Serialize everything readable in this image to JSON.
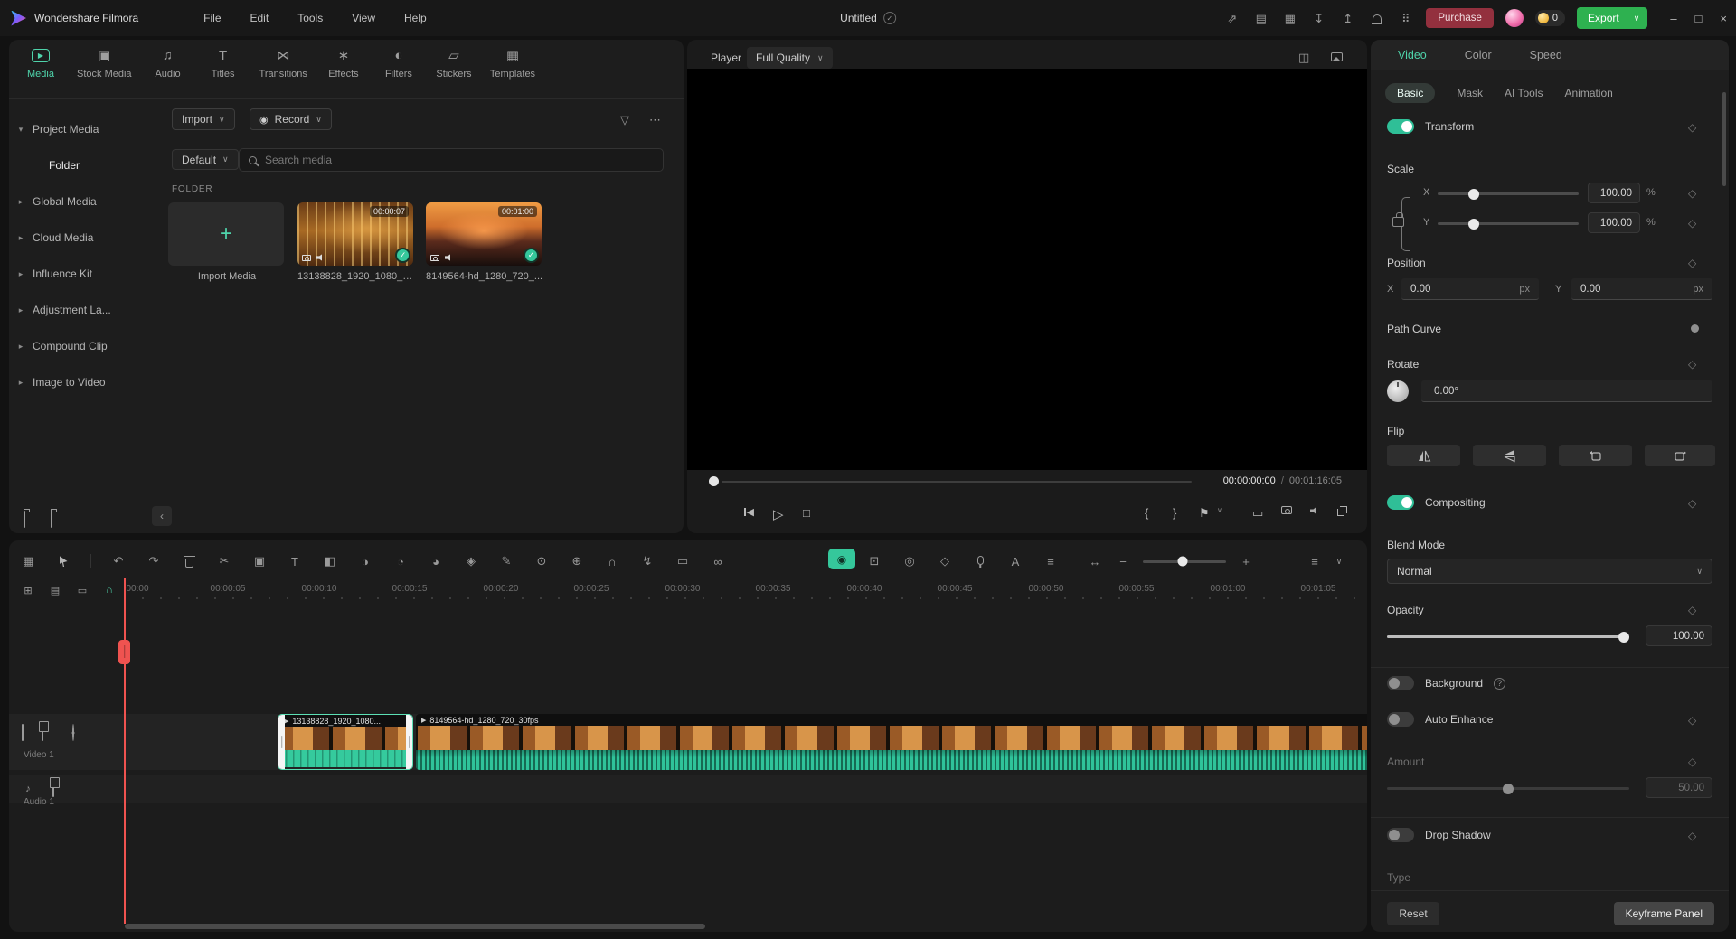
{
  "icons": {
    "caret_down": "▾",
    "caret_right": "▸",
    "chevron": "∨",
    "chevron_left": "‹",
    "plus": "+",
    "minus": "−",
    "check": "✓",
    "more": "⋯",
    "filter": "▽",
    "record": "◉",
    "play": "▶",
    "play_outline": "▷",
    "play_back": "◀",
    "stop": "□",
    "flag": "⚑",
    "brace_l": "{",
    "brace_r": "}",
    "undo": "↶",
    "redo": "↷",
    "scissors": "✂",
    "crop": "▣",
    "letter_t": "T",
    "letter_a": "A",
    "mask": "◧",
    "chroma": "◑",
    "clock": "◔",
    "dot_circle": "⊙",
    "color": "◕",
    "diamond_solid": "◈",
    "pen": "✎",
    "zoom_fit": "⊕",
    "magnet": "∩",
    "bolt": "↯",
    "grid": "▦",
    "panel": "▤",
    "rect": "▭",
    "link": "∞",
    "webcam": "◎",
    "screen": "⊡",
    "lines": "≡",
    "arrows_h": "↔",
    "dual": "◫",
    "note": "♪",
    "diamond": "◇",
    "question": "?",
    "close": "×",
    "maximize_sq": "□",
    "dash": "–",
    "share": "⇗",
    "apps": "⠿",
    "down": "↧",
    "up": "↥",
    "boxplus": "⊞",
    "tab_stock": "▣",
    "tab_audio": "♫",
    "tab_titles": "T",
    "tab_transitions": "⋈",
    "tab_effects": "∗",
    "tab_filters": "◐",
    "tab_stickers": "▱",
    "tab_templates": "▦"
  },
  "titlebar": {
    "app_name": "Wondershare Filmora",
    "menus": [
      "File",
      "Edit",
      "Tools",
      "View",
      "Help"
    ],
    "project_title": "Untitled",
    "purchase_label": "Purchase",
    "coin_count": "0",
    "export_label": "Export"
  },
  "media_panel": {
    "tabs": [
      {
        "label": "Media"
      },
      {
        "label": "Stock Media"
      },
      {
        "label": "Audio"
      },
      {
        "label": "Titles"
      },
      {
        "label": "Transitions"
      },
      {
        "label": "Effects"
      },
      {
        "label": "Filters"
      },
      {
        "label": "Stickers"
      },
      {
        "label": "Templates"
      }
    ],
    "sidebar": [
      {
        "label": "Project Media"
      },
      {
        "label": "Folder"
      },
      {
        "label": "Global Media"
      },
      {
        "label": "Cloud Media"
      },
      {
        "label": "Influence Kit"
      },
      {
        "label": "Adjustment La..."
      },
      {
        "label": "Compound Clip"
      },
      {
        "label": "Image to Video"
      }
    ],
    "toolbar": {
      "import_label": "Import",
      "record_label": "Record",
      "sort_label": "Default",
      "search_placeholder": "Search media"
    },
    "section_label": "FOLDER",
    "items": [
      {
        "label": "Import Media"
      },
      {
        "name": "13138828_1920_1080_3...",
        "duration": "00:00:07"
      },
      {
        "name": "8149564-hd_1280_720_...",
        "duration": "00:01:00"
      }
    ]
  },
  "player": {
    "label": "Player",
    "quality": "Full Quality",
    "current_time": "00:00:00:00",
    "time_separator": "/",
    "total_time": "00:01:16:05"
  },
  "properties": {
    "tabs": [
      {
        "label": "Video"
      },
      {
        "label": "Color"
      },
      {
        "label": "Speed"
      }
    ],
    "subtabs": [
      {
        "label": "Basic"
      },
      {
        "label": "Mask"
      },
      {
        "label": "AI Tools"
      },
      {
        "label": "Animation"
      }
    ],
    "transform_label": "Transform",
    "scale": {
      "label": "Scale",
      "x_label": "X",
      "x_value": "100.00",
      "x_unit": "%",
      "y_label": "Y",
      "y_value": "100.00",
      "y_unit": "%"
    },
    "position": {
      "label": "Position",
      "x_label": "X",
      "x_value": "0.00",
      "x_unit": "px",
      "y_label": "Y",
      "y_value": "0.00",
      "y_unit": "px"
    },
    "path_curve_label": "Path Curve",
    "rotate": {
      "label": "Rotate",
      "value": "0.00°"
    },
    "flip_label": "Flip",
    "compositing_label": "Compositing",
    "blend": {
      "label": "Blend Mode",
      "value": "Normal"
    },
    "opacity": {
      "label": "Opacity",
      "value": "100.00"
    },
    "background_label": "Background",
    "auto_enhance_label": "Auto Enhance",
    "amount": {
      "label": "Amount",
      "value": "50.00"
    },
    "drop_shadow_label": "Drop Shadow",
    "type_label": "Type",
    "reset_label": "Reset",
    "keyframe_panel_label": "Keyframe Panel"
  },
  "timeline": {
    "ruler_labels": [
      "00:00",
      "00:00:05",
      "00:00:10",
      "00:00:15",
      "00:00:20",
      "00:00:25",
      "00:00:30",
      "00:00:35",
      "00:00:40",
      "00:00:45",
      "00:00:50",
      "00:00:55",
      "00:01:00",
      "00:01:05"
    ],
    "tracks": [
      {
        "name": "Video 1"
      },
      {
        "name": "Audio 1"
      }
    ],
    "clips": [
      {
        "name": "13138828_1920_1080..."
      },
      {
        "name": "8149564-hd_1280_720_30fps"
      }
    ]
  }
}
